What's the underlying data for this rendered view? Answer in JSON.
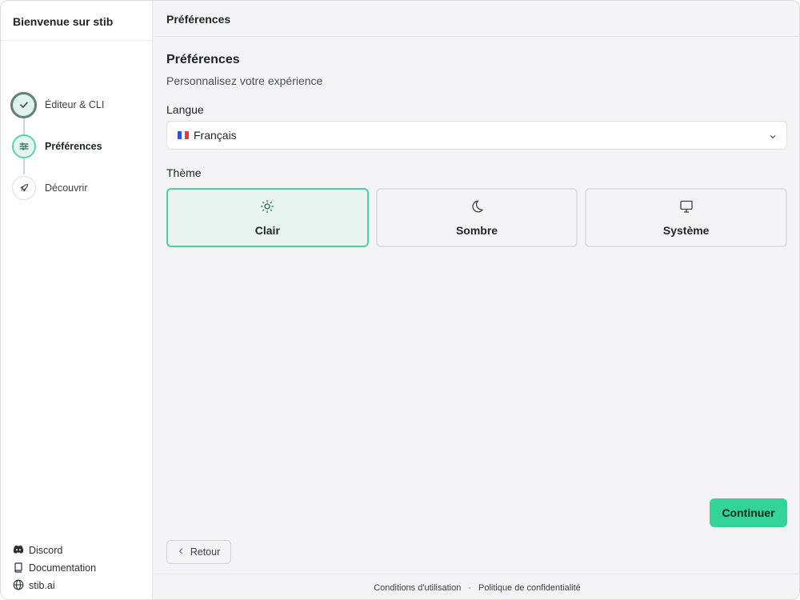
{
  "sidebar": {
    "title": "Bienvenue sur stib",
    "steps": [
      {
        "label": "Éditeur & CLI",
        "state": "done",
        "icon": "check-icon"
      },
      {
        "label": "Préférences",
        "state": "active",
        "icon": "sliders-icon"
      },
      {
        "label": "Découvrir",
        "state": "todo",
        "icon": "rocket-icon"
      }
    ],
    "links": [
      {
        "label": "Discord",
        "icon": "discord-icon"
      },
      {
        "label": "Documentation",
        "icon": "book-icon"
      },
      {
        "label": "stib.ai",
        "icon": "globe-icon"
      }
    ]
  },
  "topbar": {
    "title": "Préférences"
  },
  "main": {
    "title": "Préférences",
    "subtitle": "Personnalisez votre expérience",
    "language": {
      "label": "Langue",
      "selected": "Français",
      "flag_colors": [
        "#2f55d4",
        "#ffffff",
        "#e23b3b"
      ]
    },
    "theme": {
      "label": "Thème",
      "options": [
        {
          "label": "Clair",
          "icon": "sun-icon",
          "selected": true
        },
        {
          "label": "Sombre",
          "icon": "moon-icon",
          "selected": false
        },
        {
          "label": "Système",
          "icon": "monitor-icon",
          "selected": false
        }
      ]
    },
    "continue_label": "Continuer",
    "back_label": "Retour"
  },
  "footer": {
    "terms": "Conditions d'utilisation",
    "separator": "·",
    "privacy": "Politique de confidentialité"
  },
  "colors": {
    "accent": "#34d399",
    "selected_border": "#4fcf9f",
    "selected_bg": "#e9f3f0"
  }
}
